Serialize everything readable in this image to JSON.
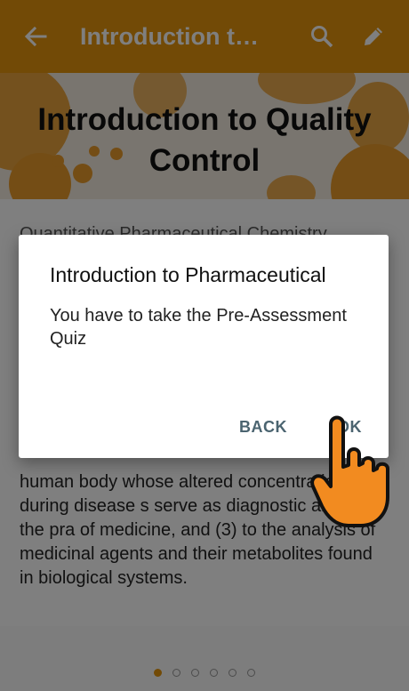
{
  "topbar": {
    "title": "Introduction t…",
    "back_icon": "arrow-left-icon",
    "search_icon": "search-icon",
    "edit_icon": "pencil-icon",
    "color": "#E5950C"
  },
  "hero": {
    "title": "Introduction to Quality Control"
  },
  "content": {
    "intro_line": "Quantitative Pharmaceutical Chemistry",
    "paragraph": "human body whose altered concentrations during disease  s serve as diagnostic aids in the pra of medicine, and (3) to the analysis of medicinal agents and their metabolites found in biological systems."
  },
  "pager": {
    "count": 6,
    "active_index": 0
  },
  "dialog": {
    "title": "Introduction to Pharmaceutical",
    "message": "You have to take the Pre-Assessment Quiz",
    "back_label": "BACK",
    "ok_label": "OK"
  },
  "overlay": {
    "pointer_icon": "pointing-hand-icon"
  }
}
